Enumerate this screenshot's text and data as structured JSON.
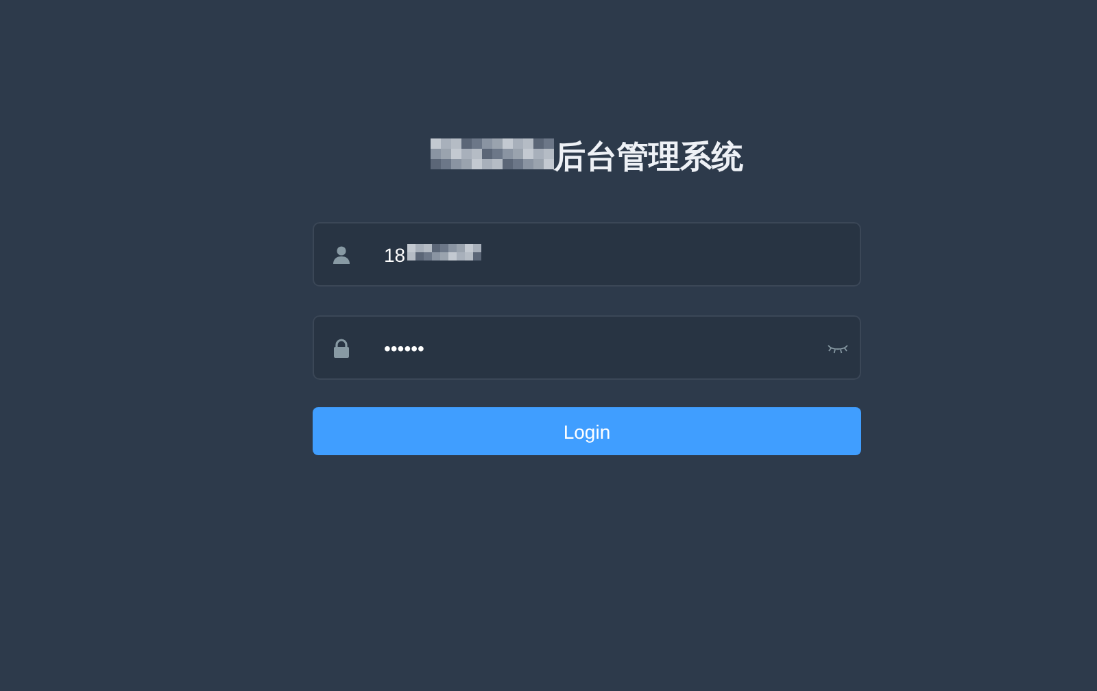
{
  "title": {
    "text": "后台管理系统",
    "redacted_prefix": true
  },
  "username": {
    "value": "18",
    "redacted_suffix": true
  },
  "password": {
    "value": "••••••",
    "show": false
  },
  "login_button": "Login"
}
